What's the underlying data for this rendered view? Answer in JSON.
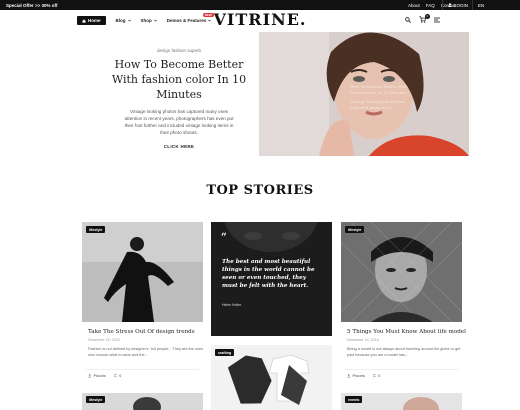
{
  "topbar": {
    "offer": "Special Offer >> 30% off",
    "links": [
      "About",
      "FAQ",
      "Contact"
    ],
    "login": "LOGIN",
    "lang": "EN"
  },
  "header": {
    "logo": "VITRINE.",
    "nav": [
      {
        "label": "Home",
        "active": true
      },
      {
        "label": "Blog"
      },
      {
        "label": "Shop"
      },
      {
        "label": "Demos & Features",
        "badge": "NEW"
      }
    ],
    "cart_count": "0"
  },
  "hero": {
    "category": "design fashion superb",
    "title": "How To Become Better With fashion color In 10 Minutes",
    "description": "Vintage looking photos has captured many ones attention in recent years, photographers has even put their foot further and included vintage looking items in their photo shoots.",
    "cta": "CLICK HERE",
    "overlay_title": "How To Become Better With fashion color In 10 Minutes",
    "overlay_desc": "Vintage looking photos has captured many ones"
  },
  "section": {
    "title": "TOP STORIES"
  },
  "cards": [
    {
      "tag": "lifestyle",
      "title": "Take The Stress Out Of design trends",
      "date": "December 15, 2016",
      "excerpt": "Fashion is not defined by designer's, but people... They are the ones who choose what to wear and the...",
      "author": "Pixcels",
      "comments": "0"
    },
    {
      "quote": "The best and most beautiful things in the world cannot be seen or even touched, they must be felt with the heart.",
      "quote_author": "Helen Keller"
    },
    {
      "tag": "lifestyle",
      "title": "5 Things You Must Know About life model",
      "date": "December 15, 2016",
      "excerpt": "Being a model is not always about traveling around the globe or get paid because you are a model has...",
      "author": "Pixcels",
      "comments": "0"
    },
    {
      "tag": "lifestyle"
    },
    {
      "tag": "crafting"
    },
    {
      "tag": "events"
    }
  ],
  "colors": {
    "dark": "#111111",
    "badge": "#e8333d",
    "hero_bg": "#d8cfcd"
  }
}
